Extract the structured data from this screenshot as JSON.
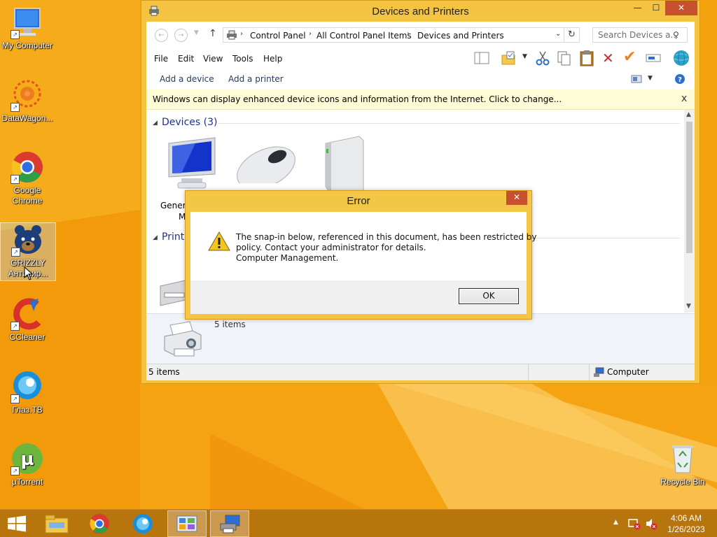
{
  "desktop": {
    "icons": [
      {
        "label": "My Computer"
      },
      {
        "label": "DataWagon..."
      },
      {
        "label_line1": "Google",
        "label_line2": "Chrome"
      },
      {
        "label_line1": "GRIZZLY",
        "label_line2": "Антивир..."
      },
      {
        "label": "CCleaner"
      },
      {
        "label": "Глаз.ТВ"
      },
      {
        "label": "µTorrent"
      },
      {
        "label": "Recycle Bin"
      }
    ]
  },
  "explorer": {
    "title": "Devices and Printers",
    "minimize_glyph": "—",
    "maximize_glyph": "☐",
    "close_glyph": "✕",
    "breadcrumb": [
      "Control Panel",
      "All Control Panel Items",
      "Devices and Printers"
    ],
    "crumb_separator": "›",
    "search_placeholder": "Search Devices a...",
    "menu": [
      "File",
      "Edit",
      "View",
      "Tools",
      "Help"
    ],
    "commands": [
      "Add a device",
      "Add a printer"
    ],
    "info_bar": "Windows can display enhanced device icons and information from the Internet. Click to change...",
    "info_close": "x",
    "devices_header": "Devices (3)",
    "device_labels": [
      "Generi",
      "M"
    ],
    "printers_header": "Printe",
    "details_text": "5 items",
    "status_left": "5 items",
    "status_right": "Computer"
  },
  "error_dialog": {
    "title": "Error",
    "close_glyph": "✕",
    "message_lines": [
      "The snap-in below, referenced in this document, has been restricted by",
      "policy. Contact your administrator for details.",
      "Computer Management."
    ],
    "ok_label": "OK"
  },
  "taskbar": {
    "time": "4:06 AM",
    "date": "1/26/2023"
  },
  "colors": {
    "desktop_orange": "#f5a50f",
    "window_frame": "#f3c341",
    "close_red": "#c7502f",
    "link_blue": "#1e395b",
    "header_blue": "#1e3287"
  }
}
